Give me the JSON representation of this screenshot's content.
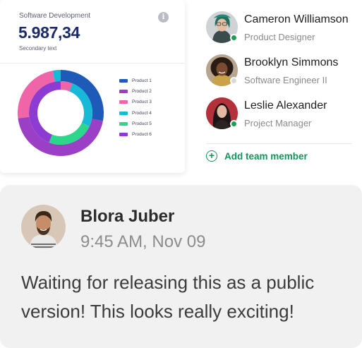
{
  "chart_card": {
    "subtitle": "Software Development",
    "value": "5.987,34",
    "secondary_text": "Secondary text",
    "info_icon": "info-icon"
  },
  "chart_data": {
    "type": "pie",
    "variant": "double-ring donut",
    "title": "",
    "legend_placement": "right",
    "categories": [
      "Product 1",
      "Product 2",
      "Product 3",
      "Product 4",
      "Product 5",
      "Product 6"
    ],
    "colors": [
      "#1e5bb8",
      "#9b3fc6",
      "#f065a8",
      "#18b9d8",
      "#2cd68a",
      "#8e3bd2"
    ],
    "series": [
      {
        "ring": "outer",
        "values": [
          28,
          45,
          24,
          3,
          0,
          0
        ]
      },
      {
        "ring": "inner",
        "values": [
          0,
          0,
          6,
          26,
          24,
          44
        ]
      }
    ]
  },
  "team": {
    "members": [
      {
        "name": "Cameron Williamson",
        "role": "Product Designer",
        "status": "online",
        "status_color": "#1f9d55"
      },
      {
        "name": "Brooklyn Simmons",
        "role": "Software Engineer II",
        "status": "offline",
        "status_color": "#d9d9d9"
      },
      {
        "name": "Leslie Alexander",
        "role": "Project Manager",
        "status": "online",
        "status_color": "#1f9d55"
      }
    ],
    "add_member_label": "Add team member",
    "add_icon": "plus-circle-icon",
    "accent": "#17935a"
  },
  "message": {
    "author": "Blora Juber",
    "time": "9:45 AM, Nov 09",
    "text": "Waiting for releasing this as a public version! This looks really exciting!"
  }
}
